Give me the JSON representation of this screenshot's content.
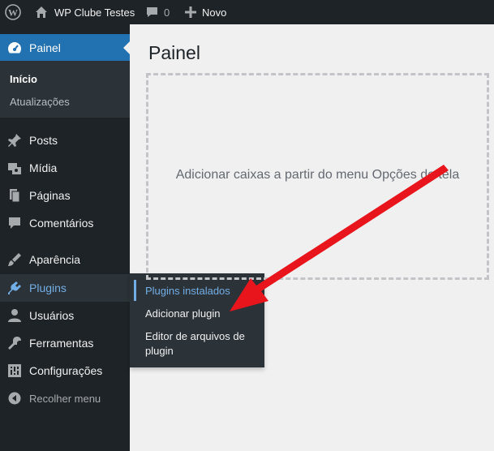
{
  "adminbar": {
    "site_name": "WP Clube Testes",
    "comments_count": "0",
    "new_label": "Novo"
  },
  "sidebar": {
    "dashboard_label": "Painel",
    "submenu": [
      "Início",
      "Atualizações"
    ],
    "items": [
      {
        "label": "Posts",
        "icon": "pin-icon"
      },
      {
        "label": "Mídia",
        "icon": "media-icon"
      },
      {
        "label": "Páginas",
        "icon": "pages-icon"
      },
      {
        "label": "Comentários",
        "icon": "comments-icon"
      },
      {
        "label": "Aparência",
        "icon": "appearance-icon"
      },
      {
        "label": "Plugins",
        "icon": "plugins-icon"
      },
      {
        "label": "Usuários",
        "icon": "users-icon"
      },
      {
        "label": "Ferramentas",
        "icon": "tools-icon"
      },
      {
        "label": "Configurações",
        "icon": "settings-icon"
      }
    ],
    "collapse_label": "Recolher menu"
  },
  "flyout": {
    "items": [
      "Plugins instalados",
      "Adicionar plugin",
      "Editor de arquivos de plugin"
    ]
  },
  "main": {
    "title": "Painel",
    "empty_text": "Adicionar caixas a partir do menu Opções de tela"
  },
  "colors": {
    "accent": "#2271b1",
    "hover_text": "#72aee6",
    "annotation_arrow": "#e8161c"
  }
}
